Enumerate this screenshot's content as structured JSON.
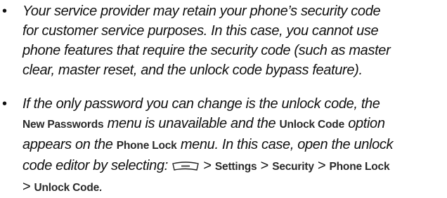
{
  "bullets": [
    {
      "symbol": "•",
      "lines": [
        "Your service provider may retain your phone’s security code",
        "for customer service purposes. In this case, you cannot use",
        "phone features that require the security code (such as master",
        "clear, master reset, and the unlock code bypass feature)."
      ]
    },
    {
      "symbol": "•",
      "line1": "If the only password you can change is the unlock code, the",
      "line2": {
        "menu1": "New Passwords",
        "text1": " menu is unavailable and the ",
        "menu2": "Unlock Code",
        "text2": " option"
      },
      "line3": {
        "text1": "appears on the ",
        "menu1": "Phone Lock",
        "text2": " menu. In this case, open the unlock"
      },
      "line4": {
        "text1": "code editor by selecting: ",
        "softkey_icon": "menu-softkey-icon",
        "sep": " > ",
        "menu1": "Settings",
        "menu2": "Security",
        "menu3": "Phone Lock"
      },
      "line5": {
        "sep": "> ",
        "menu1": "Unlock Code",
        "text1": "."
      }
    }
  ]
}
